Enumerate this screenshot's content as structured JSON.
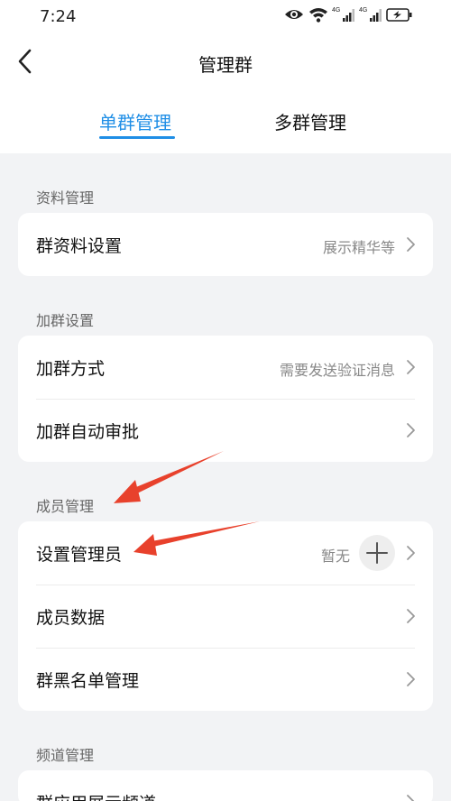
{
  "status_bar": {
    "time": "7:24",
    "icons": [
      "eye-icon",
      "wifi-icon",
      "signal-4g-icon",
      "signal-4g-icon",
      "battery-charging-icon"
    ],
    "network_label_1": "4G",
    "network_label_2": "4G"
  },
  "nav": {
    "title": "管理群",
    "back_icon": "chevron-left-icon"
  },
  "tabs": [
    {
      "label": "单群管理",
      "active": true
    },
    {
      "label": "多群管理",
      "active": false
    }
  ],
  "sections": [
    {
      "title": "资料管理",
      "rows": [
        {
          "label": "群资料设置",
          "value": "展示精华等"
        }
      ]
    },
    {
      "title": "加群设置",
      "rows": [
        {
          "label": "加群方式",
          "value": "需要发送验证消息"
        },
        {
          "label": "加群自动审批",
          "value": ""
        }
      ]
    },
    {
      "title": "成员管理",
      "rows": [
        {
          "label": "设置管理员",
          "value": "暂无",
          "action_icon": "plus-icon"
        },
        {
          "label": "成员数据",
          "value": ""
        },
        {
          "label": "群黑名单管理",
          "value": ""
        }
      ]
    },
    {
      "title": "频道管理",
      "rows": [
        {
          "label": "群应用展示频道",
          "value": ""
        }
      ]
    }
  ],
  "colors": {
    "accent": "#1f8ee6",
    "annotation_arrow": "#e8412c",
    "background": "#f2f3f5"
  }
}
